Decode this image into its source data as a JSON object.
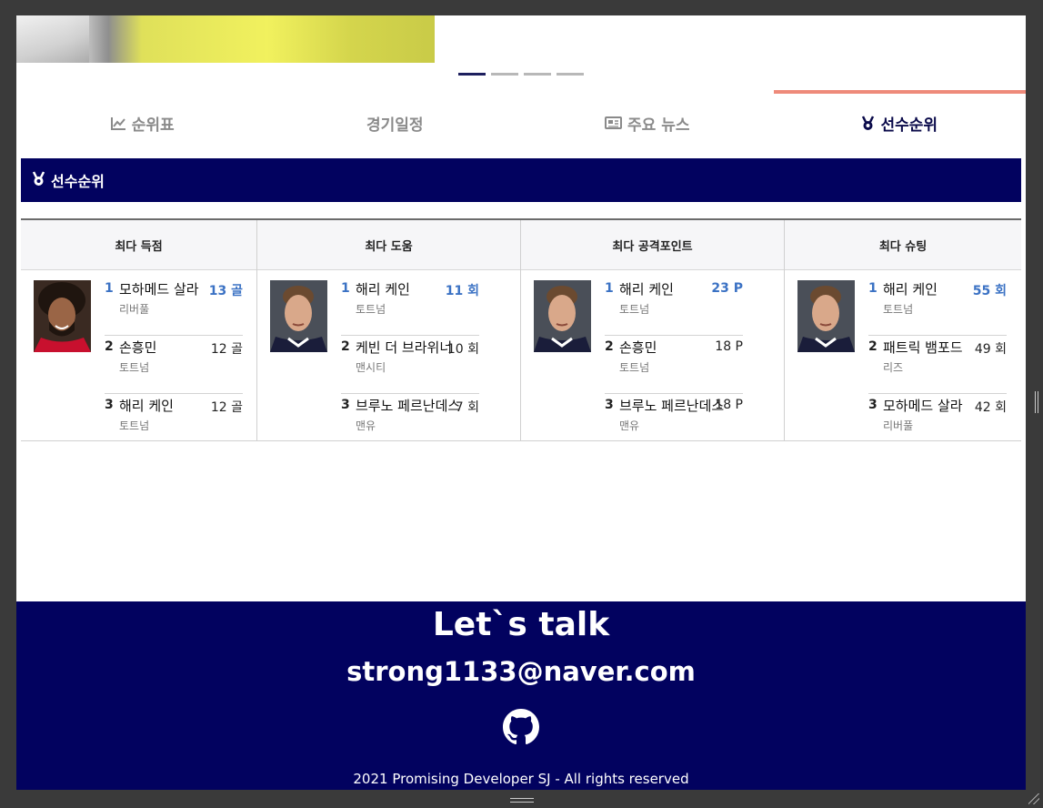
{
  "slider": {
    "dots": 4,
    "active_index": 0
  },
  "tabs": [
    {
      "label": "순위표",
      "icon": "chart-line-icon",
      "active": false
    },
    {
      "label": "경기일정",
      "icon": "",
      "active": false
    },
    {
      "label": "주요 뉴스",
      "icon": "newspaper-icon",
      "active": false
    },
    {
      "label": "선수순위",
      "icon": "medal-icon",
      "active": true
    }
  ],
  "section": {
    "title": "선수순위",
    "icon": "medal-icon"
  },
  "ranking": {
    "columns": [
      {
        "header": "최다 득점",
        "photo": "salah-photo",
        "rows": [
          {
            "rank": "1",
            "name": "모하메드 살라",
            "team": "리버풀",
            "value": "13 골"
          },
          {
            "rank": "2",
            "name": "손흥민",
            "team": "토트넘",
            "value": "12 골"
          },
          {
            "rank": "3",
            "name": "해리 케인",
            "team": "토트넘",
            "value": "12 골"
          }
        ]
      },
      {
        "header": "최다 도움",
        "photo": "kane-photo",
        "rows": [
          {
            "rank": "1",
            "name": "해리 케인",
            "team": "토트넘",
            "value": "11 회"
          },
          {
            "rank": "2",
            "name": "케빈 더 브라위너",
            "team": "맨시티",
            "value": "10 회"
          },
          {
            "rank": "3",
            "name": "브루노 페르난데스",
            "team": "맨유",
            "value": "7 회"
          }
        ]
      },
      {
        "header": "최다 공격포인트",
        "photo": "kane-photo",
        "rows": [
          {
            "rank": "1",
            "name": "해리 케인",
            "team": "토트넘",
            "value": "23 P"
          },
          {
            "rank": "2",
            "name": "손흥민",
            "team": "토트넘",
            "value": "18 P"
          },
          {
            "rank": "3",
            "name": "브루노 페르난데스",
            "team": "맨유",
            "value": "18 P"
          }
        ]
      },
      {
        "header": "최다 슈팅",
        "photo": "kane-photo",
        "rows": [
          {
            "rank": "1",
            "name": "해리 케인",
            "team": "토트넘",
            "value": "55 회"
          },
          {
            "rank": "2",
            "name": "패트릭 뱀포드",
            "team": "리즈",
            "value": "49 회"
          },
          {
            "rank": "3",
            "name": "모하메드 살라",
            "team": "리버풀",
            "value": "42 회"
          }
        ]
      }
    ]
  },
  "footer": {
    "title": "Let`s talk",
    "email": "strong1133@naver.com",
    "github_icon": "github-icon",
    "copyright": "2021 Promising Developer SJ - All rights reserved"
  },
  "colors": {
    "navy": "#02025f",
    "accent_blue": "#3b72c4",
    "tab_underline": "#ee8a7a"
  }
}
